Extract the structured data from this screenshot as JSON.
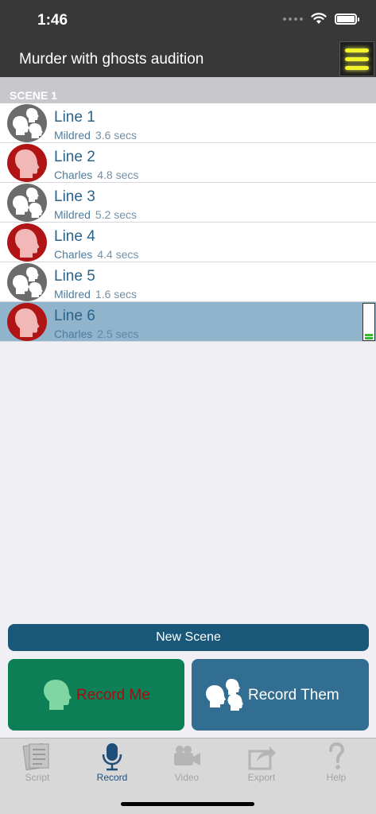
{
  "status_bar": {
    "time": "1:46"
  },
  "nav": {
    "title": "Murder with ghosts audition"
  },
  "scene": {
    "header": "SCENE 1",
    "lines": [
      {
        "name": "Line 1",
        "character": "Mildred",
        "duration": "3.6 secs",
        "avatar": "group-icon"
      },
      {
        "name": "Line 2",
        "character": "Charles",
        "duration": "4.8 secs",
        "avatar": "head-icon"
      },
      {
        "name": "Line 3",
        "character": "Mildred",
        "duration": "5.2 secs",
        "avatar": "group-icon"
      },
      {
        "name": "Line 4",
        "character": "Charles",
        "duration": "4.4 secs",
        "avatar": "head-icon"
      },
      {
        "name": "Line 5",
        "character": "Mildred",
        "duration": "1.6 secs",
        "avatar": "group-icon"
      },
      {
        "name": "Line 6",
        "character": "Charles",
        "duration": "2.5 secs",
        "avatar": "head-icon",
        "selected": true
      }
    ]
  },
  "buttons": {
    "new_scene": "New Scene",
    "record_me": "Record Me",
    "record_them": "Record Them"
  },
  "tabs": [
    {
      "label": "Script",
      "icon": "script-icon"
    },
    {
      "label": "Record",
      "icon": "microphone-icon",
      "active": true
    },
    {
      "label": "Video",
      "icon": "video-camera-icon"
    },
    {
      "label": "Export",
      "icon": "export-icon"
    },
    {
      "label": "Help",
      "icon": "question-icon"
    }
  ],
  "colors": {
    "nav_background": "#383838",
    "menu_accent": "#f4f42a",
    "line_text": "#2a6289",
    "selected_row": "#8fb4cc",
    "me_avatar": "#b01414",
    "them_avatar": "#6b6b6b",
    "new_scene_button": "#195878",
    "record_me_button": "#0d7f57",
    "record_me_label": "#a00f0f",
    "record_them_button": "#326d92",
    "active_tab": "#1f4e7a"
  }
}
